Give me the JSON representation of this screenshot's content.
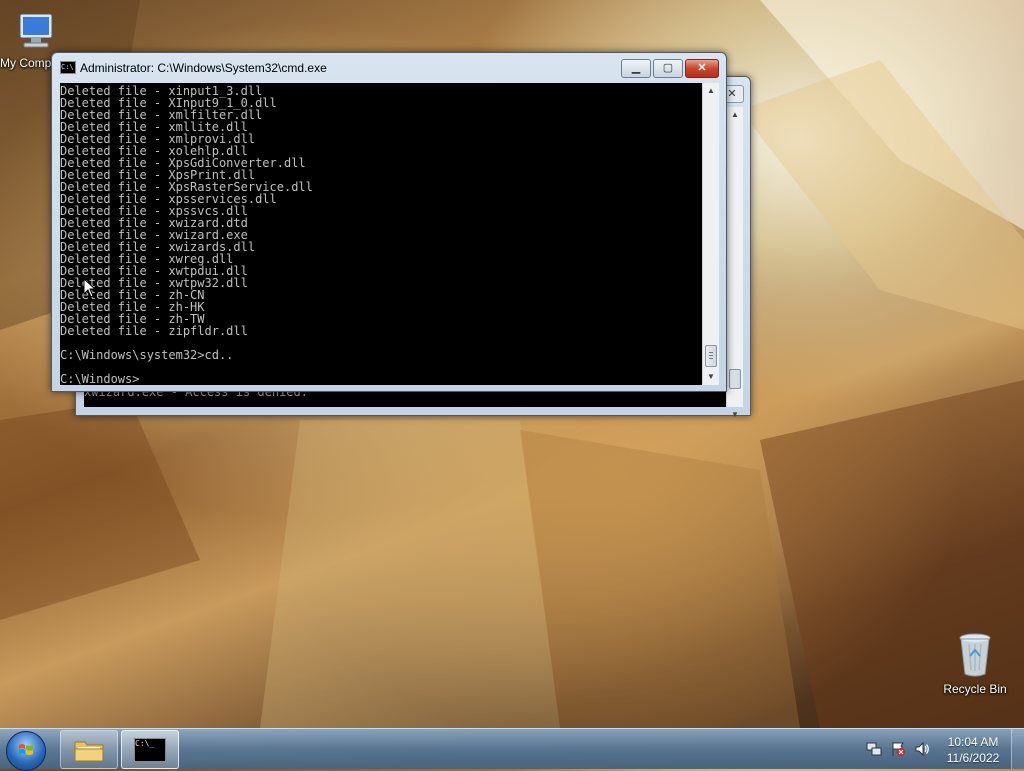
{
  "desktop": {
    "icons": [
      {
        "label": "My Computer",
        "icon": "computer-icon"
      },
      {
        "label": "Recycle Bin",
        "icon": "recycle-bin-icon"
      }
    ]
  },
  "back_window": {
    "console_partial_text": "xwizard.exe - Access is denied."
  },
  "cmd_window": {
    "title": "Administrator: C:\\Windows\\System32\\cmd.exe",
    "buttons": {
      "minimize": "minimize-icon",
      "maximize": "maximize-icon",
      "close": "close-icon"
    },
    "lines": [
      "Deleted file - xinput1_3.dll",
      "Deleted file - XInput9_1_0.dll",
      "Deleted file - xmlfilter.dll",
      "Deleted file - xmllite.dll",
      "Deleted file - xmlprovi.dll",
      "Deleted file - xolehlp.dll",
      "Deleted file - XpsGdiConverter.dll",
      "Deleted file - XpsPrint.dll",
      "Deleted file - XpsRasterService.dll",
      "Deleted file - xpsservices.dll",
      "Deleted file - xpssvcs.dll",
      "Deleted file - xwizard.dtd",
      "Deleted file - xwizard.exe",
      "Deleted file - xwizards.dll",
      "Deleted file - xwreg.dll",
      "Deleted file - xwtpdui.dll",
      "Deleted file - xwtpw32.dll",
      "Deleted file - zh-CN",
      "Deleted file - zh-HK",
      "Deleted file - zh-TW",
      "Deleted file - zipfldr.dll",
      "",
      "C:\\Windows\\system32>cd..",
      "",
      "C:\\Windows>"
    ]
  },
  "taskbar": {
    "start": "start-orb-icon",
    "pinned": [
      {
        "name": "explorer",
        "icon": "folder-icon"
      },
      {
        "name": "cmd",
        "icon": "cmd-icon"
      }
    ],
    "tray_icons": [
      "network-icon",
      "action-center-icon",
      "volume-icon"
    ],
    "time": "10:04 AM",
    "date": "11/6/2022"
  }
}
